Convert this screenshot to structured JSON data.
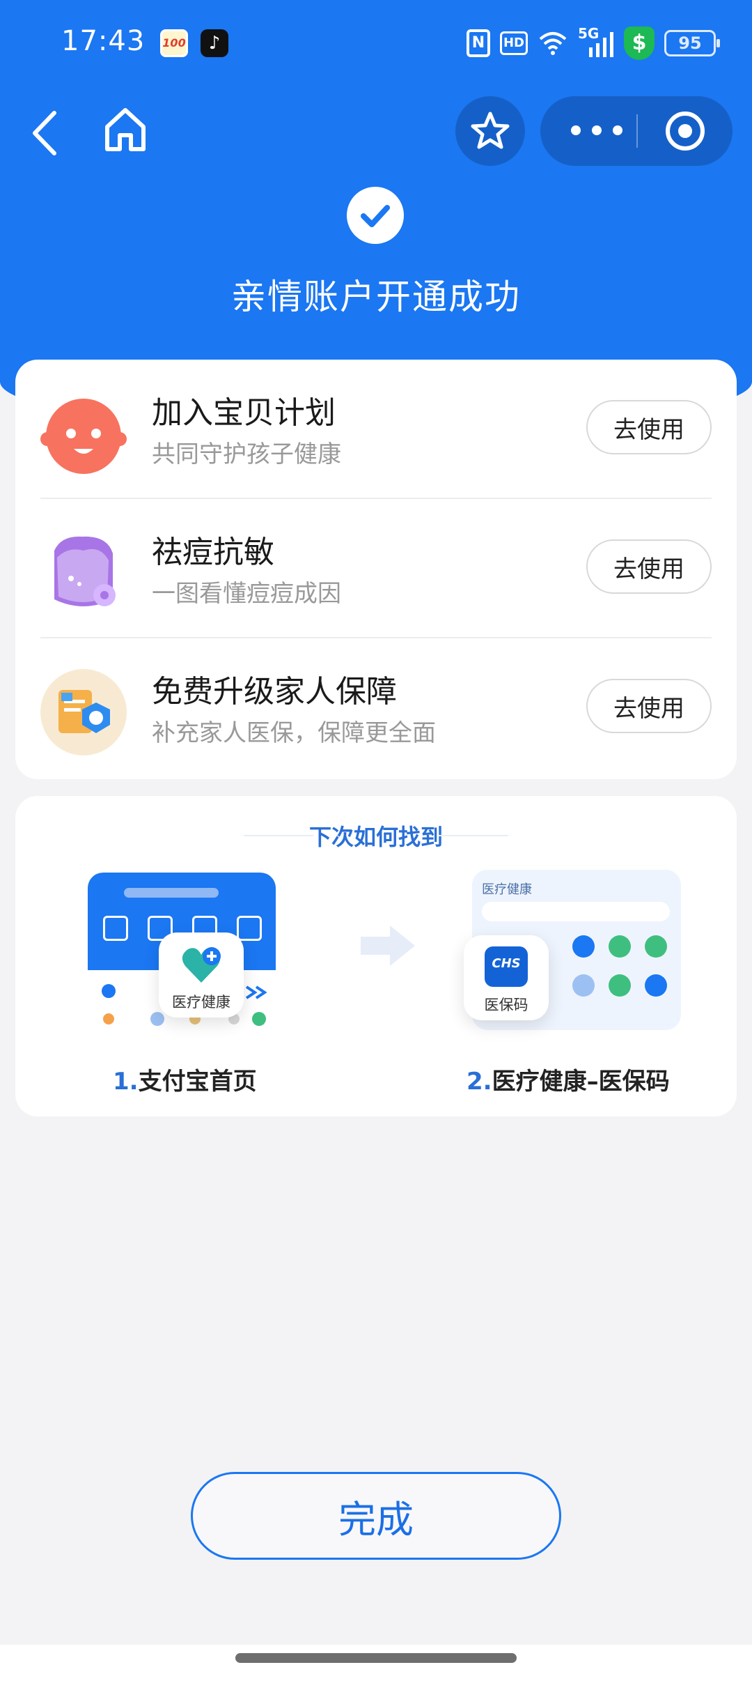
{
  "status_bar": {
    "time": "17:43",
    "app_badge": "100",
    "nfc": "N",
    "hd": "HD",
    "network": "5G",
    "battery": "95",
    "shield": "$"
  },
  "nav": {
    "back": "back-icon",
    "home": "home-icon",
    "favorite": "star-icon",
    "more": "more-icon",
    "record": "target-icon"
  },
  "header": {
    "title": "亲情账户开通成功"
  },
  "features": [
    {
      "name": "加入宝贝计划",
      "sub": "共同守护孩子健康",
      "button": "去使用",
      "icon": "baby-icon"
    },
    {
      "name": "祛痘抗敏",
      "sub": "一图看懂痘痘成因",
      "button": "去使用",
      "icon": "face-care-icon"
    },
    {
      "name": "免费升级家人保障",
      "sub": "补充家人医保，保障更全面",
      "button": "去使用",
      "icon": "insurance-icon"
    }
  ],
  "find": {
    "title": "下次如何找到",
    "stepA": {
      "num": "1.",
      "label": "支付宝首页",
      "app_label": "医疗健康"
    },
    "stepB": {
      "num": "2.",
      "label": "医疗健康–医保码",
      "app_label": "医保码",
      "screen_title": "医疗健康",
      "app_logo": "CHS"
    }
  },
  "done_button": "完成",
  "colors": {
    "brand": "#1b77f2",
    "accent": "#2a6fd6"
  }
}
